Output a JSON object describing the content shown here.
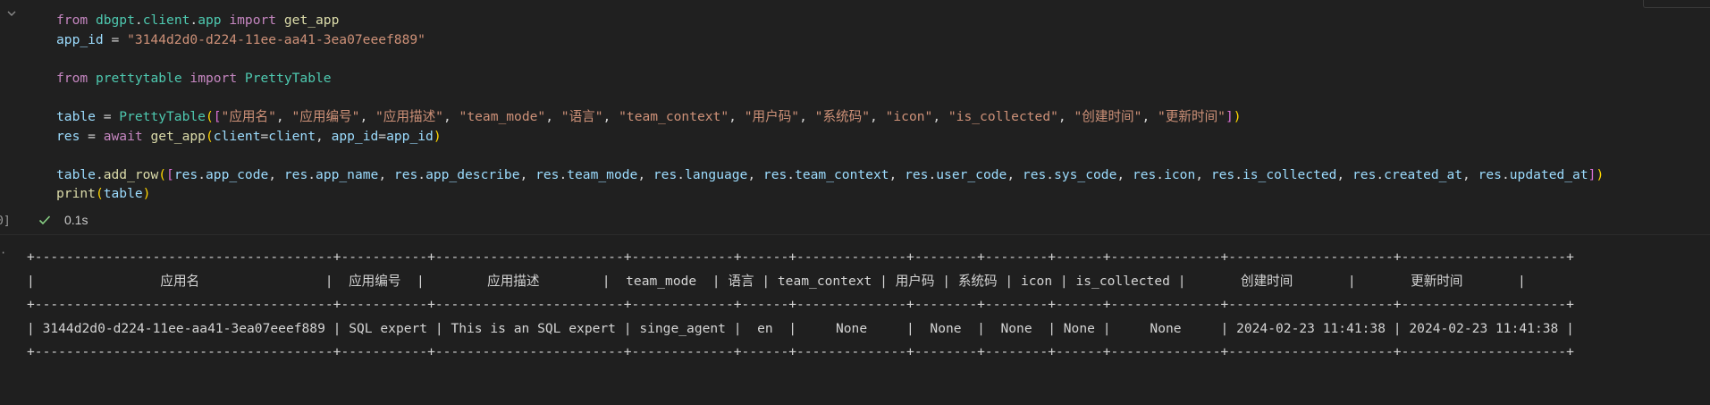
{
  "cell": {
    "code_lines": [
      [
        [
          "kw",
          "from"
        ],
        [
          "op",
          " "
        ],
        [
          "mod",
          "dbgpt"
        ],
        [
          "op",
          "."
        ],
        [
          "mod",
          "client"
        ],
        [
          "op",
          "."
        ],
        [
          "mod",
          "app"
        ],
        [
          "op",
          " "
        ],
        [
          "kw",
          "import"
        ],
        [
          "op",
          " "
        ],
        [
          "fn",
          "get_app"
        ]
      ],
      [
        [
          "var",
          "app_id"
        ],
        [
          "op",
          " = "
        ],
        [
          "str",
          "\"3144d2d0-d224-11ee-aa41-3ea07eeef889\""
        ]
      ],
      [],
      [
        [
          "kw",
          "from"
        ],
        [
          "op",
          " "
        ],
        [
          "mod",
          "prettytable"
        ],
        [
          "op",
          " "
        ],
        [
          "kw",
          "import"
        ],
        [
          "op",
          " "
        ],
        [
          "mod",
          "PrettyTable"
        ]
      ],
      [],
      [
        [
          "var",
          "table"
        ],
        [
          "op",
          " = "
        ],
        [
          "mod",
          "PrettyTable"
        ],
        [
          "br1",
          "("
        ],
        [
          "br2",
          "["
        ],
        [
          "str",
          "\"应用名\""
        ],
        [
          "op",
          ", "
        ],
        [
          "str",
          "\"应用编号\""
        ],
        [
          "op",
          ", "
        ],
        [
          "str",
          "\"应用描述\""
        ],
        [
          "op",
          ", "
        ],
        [
          "str",
          "\"team_mode\""
        ],
        [
          "op",
          ", "
        ],
        [
          "str",
          "\"语言\""
        ],
        [
          "op",
          ", "
        ],
        [
          "str",
          "\"team_context\""
        ],
        [
          "op",
          ", "
        ],
        [
          "str",
          "\"用户码\""
        ],
        [
          "op",
          ", "
        ],
        [
          "str",
          "\"系统码\""
        ],
        [
          "op",
          ", "
        ],
        [
          "str",
          "\"icon\""
        ],
        [
          "op",
          ", "
        ],
        [
          "str",
          "\"is_collected\""
        ],
        [
          "op",
          ", "
        ],
        [
          "str",
          "\"创建时间\""
        ],
        [
          "op",
          ", "
        ],
        [
          "str",
          "\"更新时间\""
        ],
        [
          "br2",
          "]"
        ],
        [
          "br1",
          ")"
        ]
      ],
      [
        [
          "var",
          "res"
        ],
        [
          "op",
          " = "
        ],
        [
          "kw",
          "await"
        ],
        [
          "op",
          " "
        ],
        [
          "fn",
          "get_app"
        ],
        [
          "br1",
          "("
        ],
        [
          "var",
          "client"
        ],
        [
          "op",
          "="
        ],
        [
          "var",
          "client"
        ],
        [
          "op",
          ", "
        ],
        [
          "var",
          "app_id"
        ],
        [
          "op",
          "="
        ],
        [
          "var",
          "app_id"
        ],
        [
          "br1",
          ")"
        ]
      ],
      [],
      [
        [
          "var",
          "table"
        ],
        [
          "op",
          "."
        ],
        [
          "fn",
          "add_row"
        ],
        [
          "br1",
          "("
        ],
        [
          "br2",
          "["
        ],
        [
          "var",
          "res"
        ],
        [
          "op",
          "."
        ],
        [
          "var",
          "app_code"
        ],
        [
          "op",
          ", "
        ],
        [
          "var",
          "res"
        ],
        [
          "op",
          "."
        ],
        [
          "var",
          "app_name"
        ],
        [
          "op",
          ", "
        ],
        [
          "var",
          "res"
        ],
        [
          "op",
          "."
        ],
        [
          "var",
          "app_describe"
        ],
        [
          "op",
          ", "
        ],
        [
          "var",
          "res"
        ],
        [
          "op",
          "."
        ],
        [
          "var",
          "team_mode"
        ],
        [
          "op",
          ", "
        ],
        [
          "var",
          "res"
        ],
        [
          "op",
          "."
        ],
        [
          "var",
          "language"
        ],
        [
          "op",
          ", "
        ],
        [
          "var",
          "res"
        ],
        [
          "op",
          "."
        ],
        [
          "var",
          "team_context"
        ],
        [
          "op",
          ", "
        ],
        [
          "var",
          "res"
        ],
        [
          "op",
          "."
        ],
        [
          "var",
          "user_code"
        ],
        [
          "op",
          ", "
        ],
        [
          "var",
          "res"
        ],
        [
          "op",
          "."
        ],
        [
          "var",
          "sys_code"
        ],
        [
          "op",
          ", "
        ],
        [
          "var",
          "res"
        ],
        [
          "op",
          "."
        ],
        [
          "var",
          "icon"
        ],
        [
          "op",
          ", "
        ],
        [
          "var",
          "res"
        ],
        [
          "op",
          "."
        ],
        [
          "var",
          "is_collected"
        ],
        [
          "op",
          ", "
        ],
        [
          "var",
          "res"
        ],
        [
          "op",
          "."
        ],
        [
          "var",
          "created_at"
        ],
        [
          "op",
          ", "
        ],
        [
          "var",
          "res"
        ],
        [
          "op",
          "."
        ],
        [
          "var",
          "updated_at"
        ],
        [
          "br2",
          "]"
        ],
        [
          "br1",
          ")"
        ]
      ],
      [
        [
          "fn",
          "print"
        ],
        [
          "br1",
          "("
        ],
        [
          "var",
          "table"
        ],
        [
          "br1",
          ")"
        ]
      ]
    ],
    "exec_count": "0]",
    "status_time": "0.1s",
    "status_icon": "check-icon"
  },
  "output": {
    "marker": "·",
    "lines": [
      "+--------------------------------------+-----------+------------------------+-------------+------+--------------+--------+--------+------+--------------+---------------------+---------------------+",
      "|                应用名                |  应用编号  |        应用描述        |  team_mode  | 语言 | team_context | 用户码 | 系统码 | icon | is_collected |       创建时间       |       更新时间       |",
      "+--------------------------------------+-----------+------------------------+-------------+------+--------------+--------+--------+------+--------------+---------------------+---------------------+",
      "| 3144d2d0-d224-11ee-aa41-3ea07eeef889 | SQL expert | This is an SQL expert | singe_agent |  en  |     None     |  None  |  None  | None |     None     | 2024-02-23 11:41:38 | 2024-02-23 11:41:38 |",
      "+--------------------------------------+-----------+------------------------+-------------+------+--------------+--------+--------+------+--------------+---------------------+---------------------+"
    ]
  }
}
